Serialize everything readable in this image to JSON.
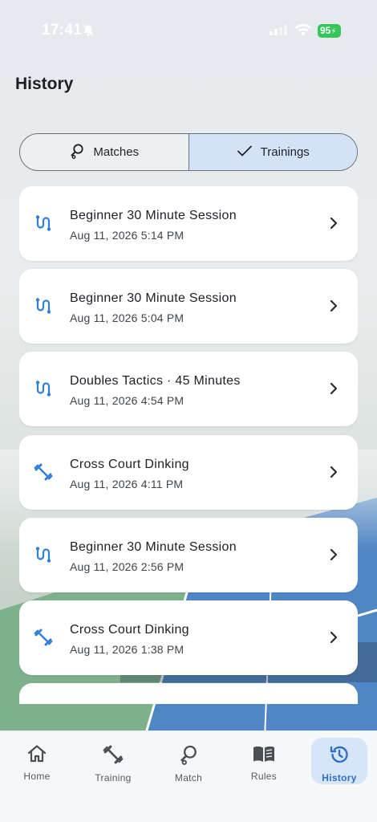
{
  "status_bar": {
    "time": "17:41",
    "battery": "95"
  },
  "header": {
    "title": "History"
  },
  "segmented": {
    "matches_label": "Matches",
    "trainings_label": "Trainings",
    "selected": "Trainings"
  },
  "items": [
    {
      "title": "Beginner 30 Minute Session",
      "date": "Aug 11, 2026 5:14 PM",
      "icon": "route-icon"
    },
    {
      "title": "Beginner 30 Minute Session",
      "date": "Aug 11, 2026 5:04 PM",
      "icon": "route-icon"
    },
    {
      "title": "Doubles Tactics · 45 Minutes",
      "date": "Aug 11, 2026 4:54 PM",
      "icon": "route-icon"
    },
    {
      "title": "Cross Court Dinking",
      "date": "Aug 11, 2026 4:11 PM",
      "icon": "dumbbell-icon"
    },
    {
      "title": "Beginner 30 Minute Session",
      "date": "Aug 11, 2026 2:56 PM",
      "icon": "route-icon"
    },
    {
      "title": "Cross Court Dinking",
      "date": "Aug 11, 2026 1:38 PM",
      "icon": "dumbbell-icon"
    }
  ],
  "tabbar": {
    "items": [
      {
        "label": "Home",
        "icon": "home-icon"
      },
      {
        "label": "Training",
        "icon": "dumbbell-icon"
      },
      {
        "label": "Match",
        "icon": "paddle-icon"
      },
      {
        "label": "Rules",
        "icon": "book-icon"
      },
      {
        "label": "History",
        "icon": "history-icon"
      }
    ],
    "active": "History"
  },
  "colors": {
    "accent": "#2f7fd6",
    "active_tab_bg": "#d6e5f8",
    "segment_active_bg": "#d3e2f7",
    "battery": "#33c759"
  }
}
